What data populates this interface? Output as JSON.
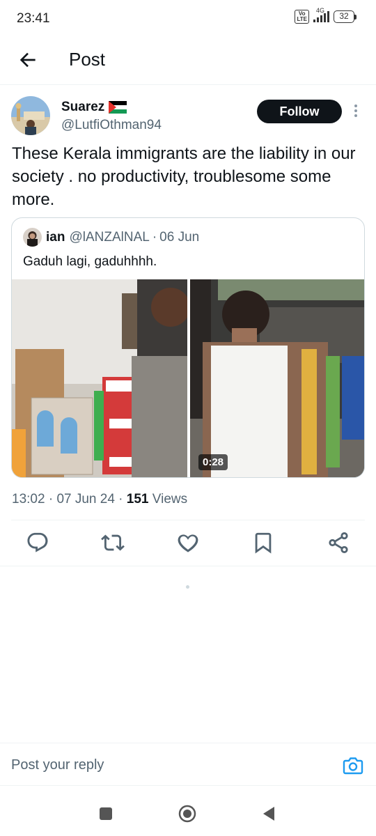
{
  "status_bar": {
    "time": "23:41",
    "volte": "Vo\nLTE",
    "network": "4G",
    "battery": "32"
  },
  "header": {
    "title": "Post",
    "back_icon": "arrow-left-icon"
  },
  "post": {
    "author_name": "Suarez",
    "author_flag": "palestine-flag-icon",
    "author_handle": "@LutfiOthman94",
    "follow_label": "Follow",
    "text": "These Kerala immigrants are the liability in our society . no productivity, troublesome some more.",
    "quote": {
      "name": "ian",
      "handle": "@lANZAlNAL",
      "separator": "·",
      "date": "06 Jun",
      "text": "Gaduh lagi, gaduhhhh.",
      "video_duration": "0:28"
    },
    "meta": {
      "time": "13:02",
      "sep1": " · ",
      "date": "07 Jun 24",
      "sep2": " · ",
      "views_count": "151",
      "views_label": " Views"
    }
  },
  "actions": [
    {
      "icon": "reply-icon"
    },
    {
      "icon": "retweet-icon"
    },
    {
      "icon": "like-icon"
    },
    {
      "icon": "bookmark-icon"
    },
    {
      "icon": "share-icon"
    }
  ],
  "reply_bar": {
    "placeholder": "Post your reply",
    "camera_icon": "camera-icon"
  },
  "colors": {
    "accent": "#1d9bf0",
    "text": "#0f1419",
    "secondary": "#536471",
    "border": "#cfd9de"
  }
}
